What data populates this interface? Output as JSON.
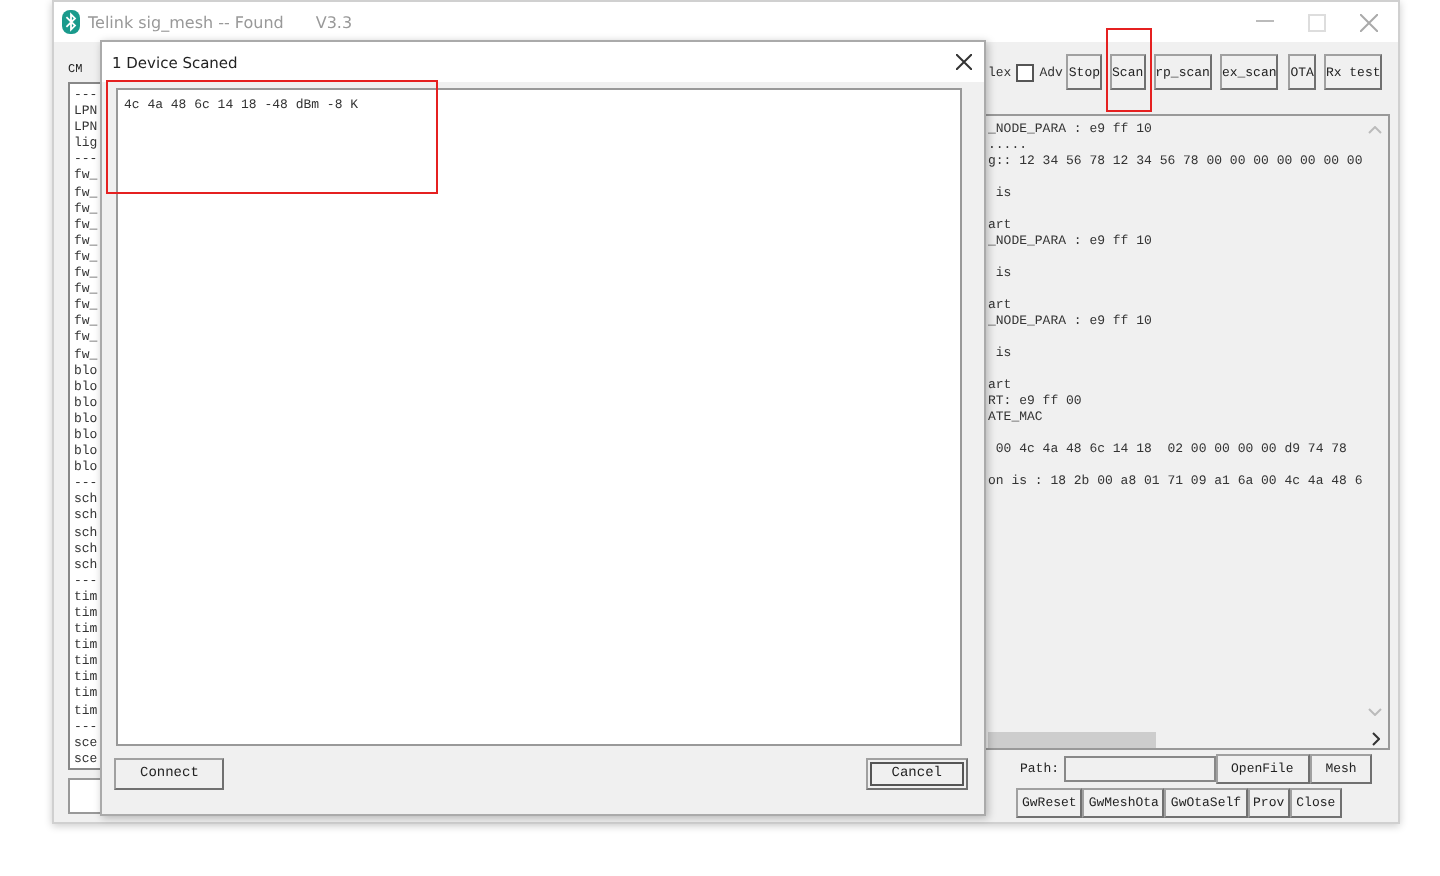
{
  "main_window": {
    "title": "Telink sig_mesh -- Found",
    "version": "V3.3",
    "cmd_label": "CM",
    "toolbar": {
      "hex_label": "lex",
      "adv_checkbox": {
        "label": "Adv",
        "checked": false
      },
      "scan_buttons": [
        "Stop",
        "Scan",
        "rp_scan",
        "ex_scan"
      ],
      "ota_buttons": [
        "OTA",
        "Rx test"
      ]
    },
    "command_list": [
      "---",
      "LPN",
      "LPN",
      "lig",
      "---",
      "fw_",
      "fw_",
      "fw_",
      "fw_",
      "fw_",
      "fw_",
      "fw_",
      "fw_",
      "fw_",
      "fw_",
      "fw_",
      "fw_",
      "blo",
      "blo",
      "blo",
      "blo",
      "blo",
      "blo",
      "blo",
      "---",
      "sch",
      "sch",
      "sch",
      "sch",
      "sch",
      "---",
      "tim",
      "tim",
      "tim",
      "tim",
      "tim",
      "tim",
      "tim",
      "tim",
      "---",
      "sce",
      "sce"
    ],
    "log_blocks": [
      [
        "_NODE_PARA : e9 ff 10",
        ".....",
        "g:: 12 34 56 78 12 34 56 78 00 00 00 00 00 00 00"
      ],
      [
        " is"
      ],
      [
        "art",
        "_NODE_PARA : e9 ff 10"
      ],
      [
        " is"
      ],
      [
        "art",
        "_NODE_PARA : e9 ff 10"
      ],
      [
        " is"
      ],
      [
        "art",
        "RT: e9 ff 00",
        "ATE_MAC"
      ],
      [
        " 00 4c 4a 48 6c 14 18  02 00 00 00 00 d9 74 78"
      ],
      [
        "on is : 18 2b 00 a8 01 71 09 a1 6a 00 4c 4a 48 6"
      ]
    ],
    "path_label": "Path:",
    "path_buttons": [
      "OpenFile",
      "Mesh"
    ],
    "bottom_buttons": [
      "GwReset",
      "GwMeshOta",
      "GwOtaSelf",
      "Prov",
      "Close"
    ]
  },
  "dialog": {
    "title": "1 Device Scaned",
    "devices": [
      {
        "text": "4c 4a 48 6c 14 18 -48 dBm -8 K",
        "selected": false
      }
    ],
    "connect_button": "Connect",
    "cancel_button": "Cancel"
  }
}
